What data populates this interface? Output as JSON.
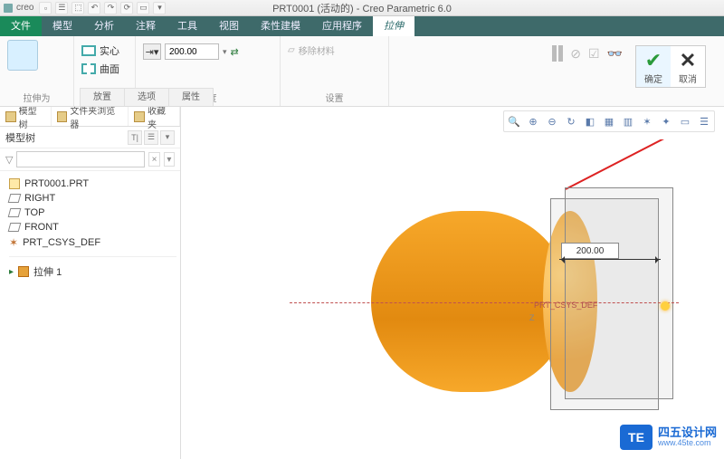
{
  "app": {
    "brand": "creo",
    "title": "PRT0001 (活动的) - Creo Parametric 6.0"
  },
  "menu": {
    "file": "文件",
    "tabs": [
      "模型",
      "分析",
      "注释",
      "工具",
      "视图",
      "柔性建模",
      "应用程序"
    ],
    "active": "拉伸"
  },
  "ribbon": {
    "group_shape": "拉伸为",
    "solid": "实心",
    "surface": "曲面",
    "group_depth": "深度",
    "depth_value": "200.00",
    "group_settings": "设置",
    "remove_material": "移除材料",
    "confirm": "确定",
    "cancel": "取消",
    "subtabs": [
      "放置",
      "选项",
      "属性"
    ]
  },
  "sidebar": {
    "tab_model_tree": "模型树",
    "tab_folder": "文件夹浏览器",
    "tab_fav": "收藏夹",
    "tree_label": "模型树",
    "root": "PRT0001.PRT",
    "datums": [
      "RIGHT",
      "TOP",
      "FRONT"
    ],
    "csys": "PRT_CSYS_DEF",
    "insert_feature": "拉伸 1"
  },
  "viewport": {
    "dimension": "200.00",
    "csys_label": "PRT_CSYS_DEF",
    "z_axis": "Z"
  },
  "watermark": {
    "badge": "TE",
    "name": "四五设计网",
    "url": "www.45te.com"
  }
}
